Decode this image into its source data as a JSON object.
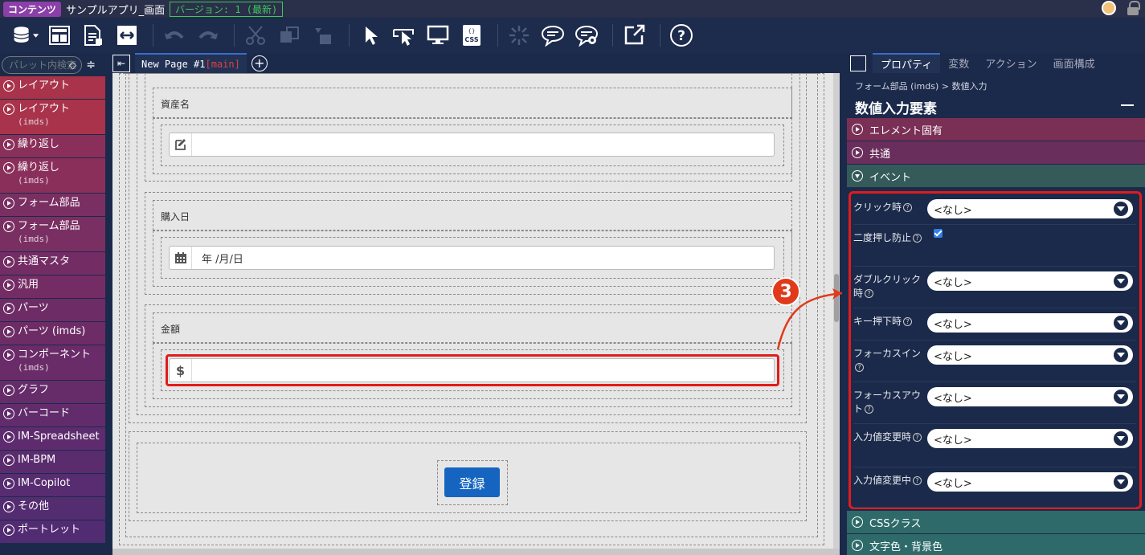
{
  "topbar": {
    "badge": "コンテンツ",
    "title": "サンプルアプリ_画面",
    "version": "バージョン: 1 (最新)"
  },
  "palette": {
    "search_placeholder": "パレット内検索",
    "items": [
      {
        "label": "レイアウト",
        "sub": "",
        "color": "#a8334a"
      },
      {
        "label": "レイアウト",
        "sub": "(imds)",
        "color": "#a8334a"
      },
      {
        "label": "繰り返し",
        "sub": "",
        "color": "#8a2f5a"
      },
      {
        "label": "繰り返し",
        "sub": "(imds)",
        "color": "#8a2f5a"
      },
      {
        "label": "フォーム部品",
        "sub": "",
        "color": "#7a2f62"
      },
      {
        "label": "フォーム部品",
        "sub": "(imds)",
        "color": "#7a2f62"
      },
      {
        "label": "共通マスタ",
        "sub": "",
        "color": "#742d64"
      },
      {
        "label": "汎用",
        "sub": "",
        "color": "#742d64"
      },
      {
        "label": "パーツ",
        "sub": "",
        "color": "#6e2c66"
      },
      {
        "label": "パーツ (imds)",
        "sub": "",
        "color": "#6e2c66"
      },
      {
        "label": "コンポーネント",
        "sub": "(imds)",
        "color": "#6a2c68"
      },
      {
        "label": "グラフ",
        "sub": "",
        "color": "#662c6a"
      },
      {
        "label": "バーコード",
        "sub": "",
        "color": "#622c6c"
      },
      {
        "label": "IM-Spreadsheet",
        "sub": "",
        "color": "#5e2c6e"
      },
      {
        "label": "IM-BPM",
        "sub": "",
        "color": "#5a2c6e"
      },
      {
        "label": "IM-Copilot",
        "sub": "",
        "color": "#582c70"
      },
      {
        "label": "その他",
        "sub": "",
        "color": "#542c70"
      },
      {
        "label": "ポートレット",
        "sub": "",
        "color": "#522c72"
      }
    ]
  },
  "page_tab": {
    "name": "New Page #1",
    "main": "[main]"
  },
  "form": {
    "field1_label": "資産名",
    "field2_label": "購入日",
    "field2_value": "年 /月/日",
    "field3_label": "金額",
    "field3_prefix": "$",
    "submit_label": "登録"
  },
  "step_marker": "3",
  "right_panel": {
    "tabs": [
      "プロパティ",
      "変数",
      "アクション",
      "画面構成"
    ],
    "breadcrumb": "フォーム部品 (imds) > 数値入力",
    "title": "数値入力要素",
    "sections_top": [
      {
        "label": "エレメント固有",
        "color": "#7a2f55"
      },
      {
        "label": "共通",
        "color": "#6a2e5c"
      },
      {
        "label": "イベント",
        "color": "#355a5a"
      }
    ],
    "events": [
      {
        "label": "クリック時",
        "value": "<なし>"
      },
      {
        "label": "二度押し防止",
        "checked": true
      },
      {
        "label": "ダブルクリック時",
        "value": "<なし>"
      },
      {
        "label": "キー押下時",
        "value": "<なし>"
      },
      {
        "label": "フォーカスイン",
        "value": "<なし>"
      },
      {
        "label": "フォーカスアウト",
        "value": "<なし>"
      },
      {
        "label": "入力値変更時",
        "value": "<なし>"
      },
      {
        "label": "入力値変更中",
        "value": "<なし>"
      }
    ],
    "sections_bottom": [
      {
        "label": "CSSクラス",
        "color": "#2e6a6a"
      },
      {
        "label": "文字色・背景色",
        "color": "#2e6a6a"
      }
    ]
  }
}
